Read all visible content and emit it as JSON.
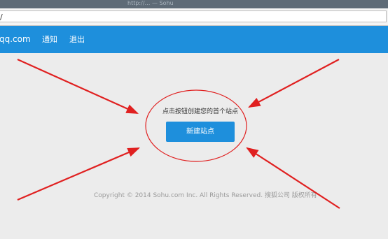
{
  "browser": {
    "title_text": "http://… — Sohu",
    "url": "/"
  },
  "nav": {
    "account": "qq.com",
    "notify": "通知",
    "logout": "退出"
  },
  "main": {
    "prompt": "点击按钮创建您的首个站点",
    "new_site_button": "新建站点"
  },
  "footer": {
    "copyright": "Copyright © 2014 Sohu.com Inc. All Rights Reserved. 搜狐公司 版权所有"
  },
  "colors": {
    "nav_bg": "#1e8fdc",
    "button_bg": "#1e8fdc",
    "annotation": "#e02020"
  }
}
